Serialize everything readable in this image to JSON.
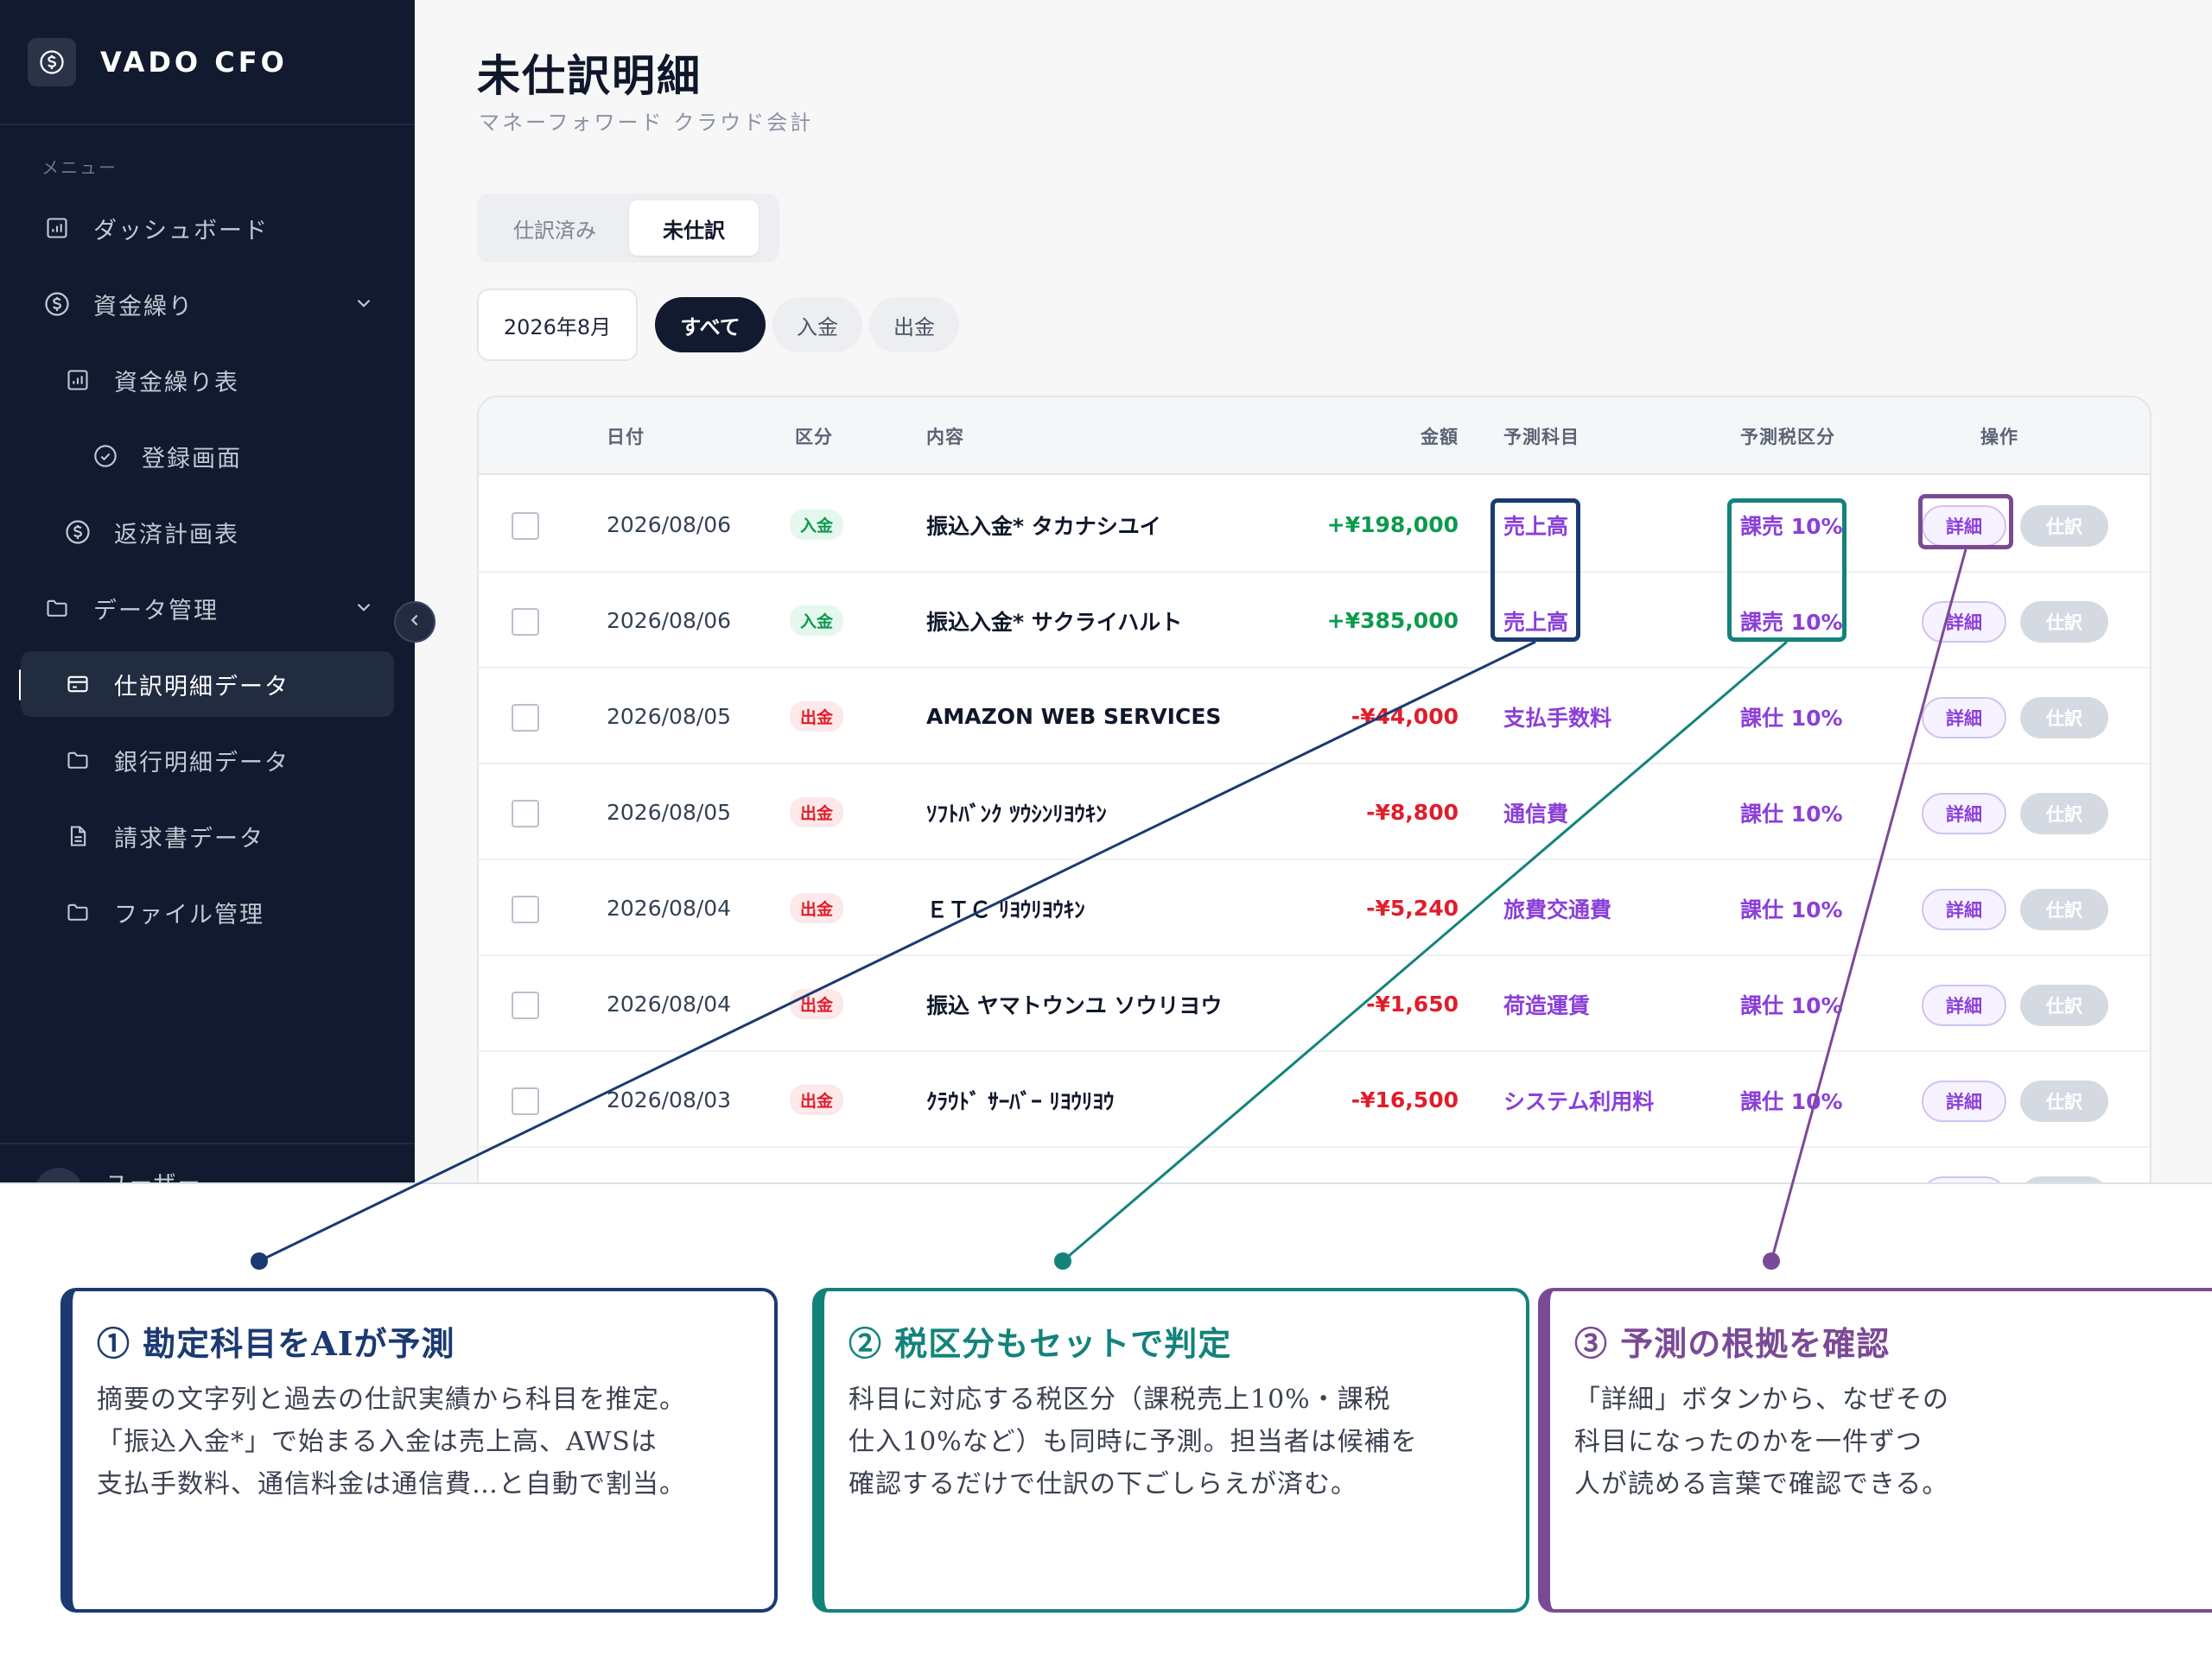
{
  "sidebar": {
    "brand": "VADO CFO",
    "menu_label": "メニュー",
    "items": [
      {
        "label": "ダッシュボード"
      },
      {
        "label": "資金繰り"
      },
      {
        "label": "資金繰り表"
      },
      {
        "label": "登録画面"
      },
      {
        "label": "返済計画表"
      },
      {
        "label": "データ管理"
      },
      {
        "label": "仕訳明細データ"
      },
      {
        "label": "銀行明細データ"
      },
      {
        "label": "請求書データ"
      },
      {
        "label": "ファイル管理"
      }
    ],
    "user": "ユーザー"
  },
  "header": {
    "title": "未仕訳明細",
    "subtitle": "マネーフォワード クラウド会計"
  },
  "tabs": {
    "done": "仕訳済み",
    "pending": "未仕訳"
  },
  "filters": {
    "month": "2026年8月",
    "all": "すべて",
    "income": "入金",
    "expense": "出金"
  },
  "table": {
    "headers": {
      "date": "日付",
      "type": "区分",
      "desc": "内容",
      "amount": "金額",
      "account": "予測科目",
      "tax": "予測税区分",
      "ops": "操作"
    },
    "buttons": {
      "detail": "詳細",
      "journal": "仕訳"
    },
    "rows": [
      {
        "date": "2026/08/06",
        "type": "入金",
        "desc": "振込入金* タカナシユイ",
        "amount": "+¥198,000",
        "account": "売上高",
        "tax": "課売 10%"
      },
      {
        "date": "2026/08/06",
        "type": "入金",
        "desc": "振込入金* サクライハルト",
        "amount": "+¥385,000",
        "account": "売上高",
        "tax": "課売 10%"
      },
      {
        "date": "2026/08/05",
        "type": "出金",
        "desc": "AMAZON WEB SERVICES",
        "amount": "-¥44,000",
        "account": "支払手数料",
        "tax": "課仕 10%"
      },
      {
        "date": "2026/08/05",
        "type": "出金",
        "desc": "ｿﾌﾄﾊﾞﾝｸ ﾂｳｼﾝﾘﾖｳｷﾝ",
        "amount": "-¥8,800",
        "account": "通信費",
        "tax": "課仕 10%"
      },
      {
        "date": "2026/08/04",
        "type": "出金",
        "desc": "ＥＴＣ ﾘﾖｳﾘﾖｳｷﾝ",
        "amount": "-¥5,240",
        "account": "旅費交通費",
        "tax": "課仕 10%"
      },
      {
        "date": "2026/08/04",
        "type": "出金",
        "desc": "振込 ヤマトウンユ ソウリヨウ",
        "amount": "-¥1,650",
        "account": "荷造運賃",
        "tax": "課仕 10%"
      },
      {
        "date": "2026/08/03",
        "type": "出金",
        "desc": "ｸﾗｳﾄﾞ ｻｰﾊﾞｰ ﾘﾖｳﾘﾖｳ",
        "amount": "-¥16,500",
        "account": "システム利用料",
        "tax": "課仕 10%"
      }
    ]
  },
  "annotations": [
    {
      "title": "① 勘定科目をAIが予測",
      "lines": [
        "摘要の文字列と過去の仕訳実績から科目を推定。",
        "「振込入金*」で始まる入金は売上高、AWSは",
        "支払手数料、通信料金は通信費…と自動で割当。"
      ]
    },
    {
      "title": "② 税区分もセットで判定",
      "lines": [
        "科目に対応する税区分（課税売上10%・課税",
        "仕入10%など）も同時に予測。担当者は候補を",
        "確認するだけで仕訳の下ごしらえが済む。"
      ]
    },
    {
      "title": "③ 予測の根拠を確認",
      "lines": [
        "「詳細」ボタンから、なぜその",
        "科目になったのかを一件ずつ",
        "人が読める言葉で確認できる。"
      ]
    }
  ],
  "colors": {
    "sidebar_bg": "#111a2e",
    "income": "#0c9a4e",
    "expense": "#e11d2a",
    "prediction": "#8b3fd9",
    "annotation_1": "#1b3a72",
    "annotation_2": "#13837a",
    "annotation_3": "#7b4a96"
  },
  "icons": {
    "brand": "dollar-circle-icon",
    "dashboard": "bar-chart-icon",
    "cashflow": "dollar-circle-icon",
    "register": "check-circle-icon",
    "folder": "folder-icon",
    "card": "credit-card-icon",
    "document": "document-icon",
    "chevron": "chevron-down-icon",
    "collapse": "chevron-left-icon"
  }
}
